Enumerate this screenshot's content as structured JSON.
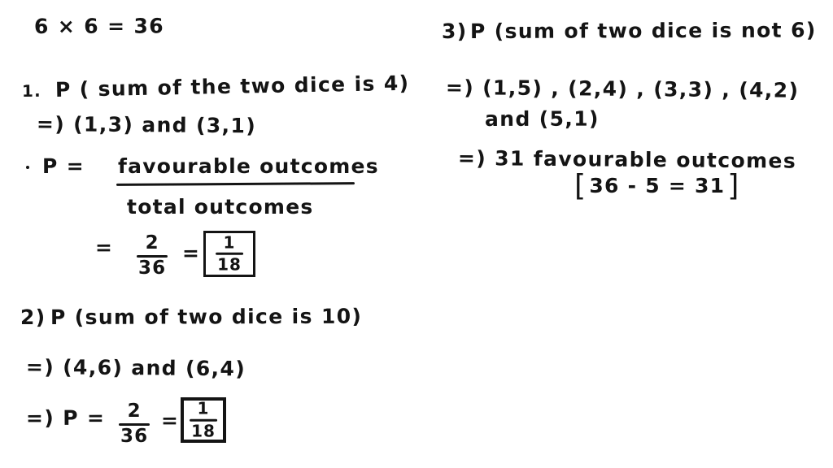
{
  "page": {
    "background_color": "#ffffff",
    "ink_color": "#141414",
    "content_type": "handwritten-probability-worksheet"
  },
  "left_column": {
    "total_outcomes_expression": "6 × 6 = 36",
    "problem1": {
      "number": "1.",
      "statement": "P ( sum of the two dice  is  4)",
      "favourable_pairs": "=)  (1,3) and (3,1)",
      "formula_label": "P   =",
      "formula_numerator": "favourable outcomes",
      "formula_denominator": "total outcomes",
      "equals_sign": "=",
      "fraction_numerator": "2",
      "fraction_denominator": "36",
      "second_equals": "=",
      "answer_numerator": "1",
      "answer_denominator": "18"
    },
    "problem2": {
      "number": "2)",
      "statement": "P (sum of two dice is  10)",
      "favourable_pairs": "=) (4,6) and (6,4)",
      "result_prefix": "=) P  =",
      "fraction_numerator": "2",
      "fraction_denominator": "36",
      "second_equals": "=",
      "answer_numerator": "1",
      "answer_denominator": "18"
    }
  },
  "right_column": {
    "problem3": {
      "number": "3)",
      "statement": "P (sum of two dice is not  6)",
      "favourable_pairs_line1": "=) (1,5) , (2,4) , (3,3) , (4,2)",
      "favourable_pairs_line2": "and  (5,1)",
      "conclusion": "=)  31  favourable outcomes",
      "bracket_open": "[",
      "bracket_expression": "36 - 5 = 31",
      "bracket_close": "]"
    }
  }
}
